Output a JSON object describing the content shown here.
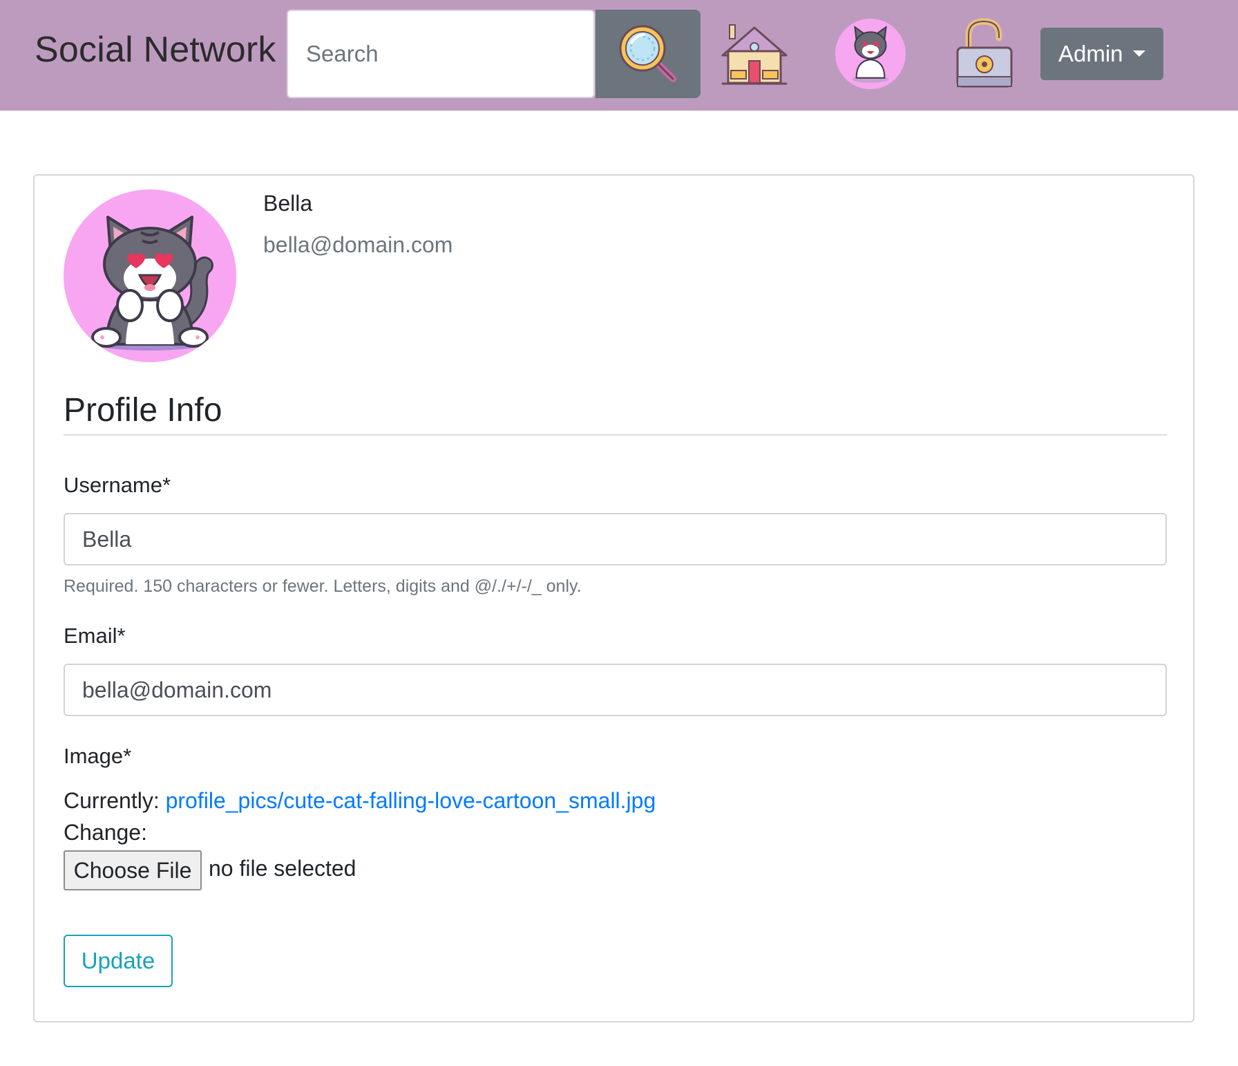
{
  "navbar": {
    "brand": "Social Network",
    "search_placeholder": "Search",
    "search_icon": "magnifier-icon",
    "home_icon": "house-icon",
    "avatar_icon": "cat-avatar-icon",
    "lock_icon": "open-lock-icon",
    "admin_label": "Admin",
    "colors": {
      "bar": "#bd9bbf",
      "button": "#6c757d"
    }
  },
  "profile": {
    "name": "Bella",
    "email": "bella@domain.com",
    "avatar_icon": "cat-avatar-icon"
  },
  "form": {
    "section_title": "Profile Info",
    "username_label": "Username*",
    "username_value": "Bella",
    "username_help": "Required. 150 characters or fewer. Letters, digits and @/./+/-/_ only.",
    "email_label": "Email*",
    "email_value": "bella@domain.com",
    "image_label": "Image*",
    "currently_label": "Currently:",
    "current_file": "profile_pics/cute-cat-falling-love-cartoon_small.jpg",
    "change_label": "Change:",
    "choose_file_label": "Choose File",
    "file_status": "no file selected",
    "update_label": "Update",
    "colors": {
      "link": "#007bff",
      "update": "#17a2b8"
    }
  }
}
